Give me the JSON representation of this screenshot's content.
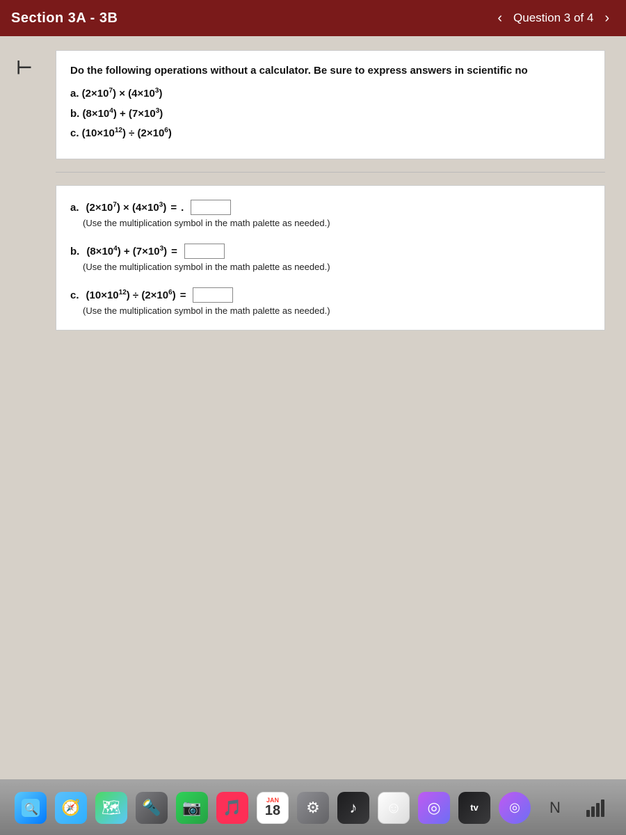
{
  "header": {
    "title": "Section 3A - 3B",
    "question_nav": "Question 3 of 4",
    "back_arrow": "‹",
    "forward_arrow": "›"
  },
  "back_button": "⊢",
  "prompt": {
    "instruction": "Do the following operations without a calculator. Be sure to express answers in scientific no",
    "problems": [
      {
        "label": "a.",
        "expr": "(2×10⁷) × (4×10³)"
      },
      {
        "label": "b.",
        "expr": "(8×10⁴) + (7×10³)"
      },
      {
        "label": "c.",
        "expr": "(10×10¹²) ÷ (2×10⁶)"
      }
    ]
  },
  "answers": [
    {
      "label": "a.",
      "expr_left": "(2×10⁷) × (4×10³)",
      "equals": "=",
      "has_dot_prefix": true,
      "hint": "(Use the multiplication symbol in the math palette as needed.)"
    },
    {
      "label": "b.",
      "expr_left": "(8×10⁴) + (7×10³)",
      "equals": "=",
      "has_dot_prefix": false,
      "hint": "(Use the multiplication symbol in the math palette as needed.)"
    },
    {
      "label": "c.",
      "expr_left": "(10×10¹²) ÷ (2×10⁶)",
      "equals": "=",
      "has_dot_prefix": false,
      "hint": "(Use the multiplication symbol in the math palette as needed.)"
    }
  ],
  "dock": {
    "items": [
      {
        "name": "Finder",
        "icon": "🔍",
        "type": "finder"
      },
      {
        "name": "Safari",
        "icon": "🧭",
        "type": "safari"
      },
      {
        "name": "Maps",
        "icon": "🗺",
        "type": "maps"
      },
      {
        "name": "Spotlight",
        "icon": "🔦",
        "type": "spotlight"
      },
      {
        "name": "FaceTime",
        "icon": "📷",
        "type": "facetime"
      },
      {
        "name": "iTunes",
        "icon": "🎵",
        "type": "itunes"
      },
      {
        "name": "18",
        "icon": "18",
        "type": "calendar"
      },
      {
        "name": "Settings",
        "icon": "⚙",
        "type": "settings"
      },
      {
        "name": "Music",
        "icon": "♪",
        "type": "music"
      },
      {
        "name": "Finder2",
        "icon": "☺",
        "type": "finder2"
      },
      {
        "name": "Siri",
        "icon": "◎",
        "type": "siri"
      },
      {
        "name": "WiFi",
        "icon": "📶",
        "type": "wifi"
      },
      {
        "name": "TV",
        "icon": "tv",
        "type": "tv"
      },
      {
        "name": "Signal",
        "icon": "N",
        "type": "signal"
      },
      {
        "name": "Bars",
        "icon": "📊",
        "type": "bars"
      }
    ]
  }
}
